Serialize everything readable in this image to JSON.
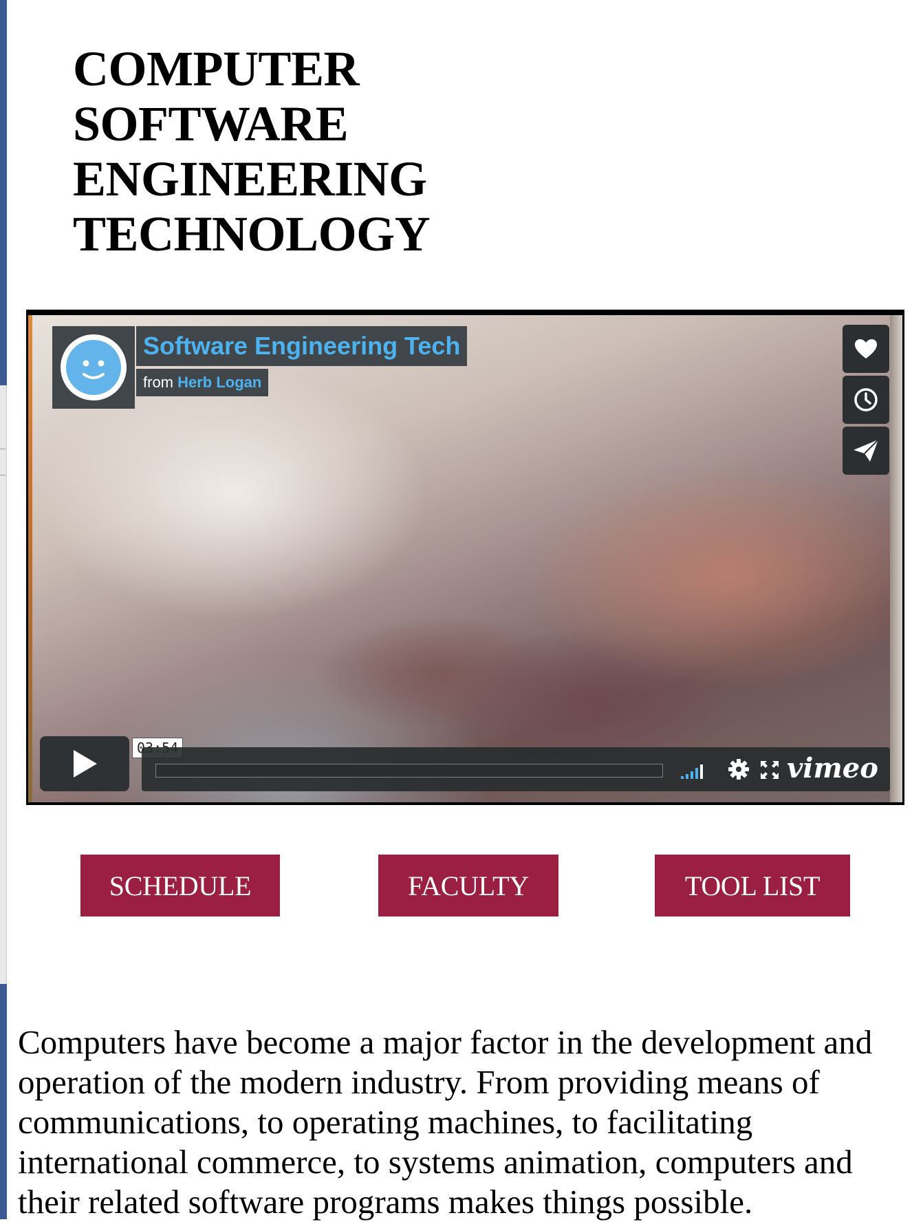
{
  "page": {
    "title_lines": [
      "COMPUTER",
      "SOFTWARE",
      "ENGINEERING",
      "TECHNOLOGY"
    ]
  },
  "video": {
    "title": "Software Engineering Tech",
    "byline_prefix": "from",
    "author": "Herb Logan",
    "duration": "03:54",
    "progress": 0,
    "provider_logo": "vimeo",
    "side_buttons": [
      {
        "icon": "heart-icon",
        "name": "like-button"
      },
      {
        "icon": "clock-icon",
        "name": "watch-later-button"
      },
      {
        "icon": "paper-plane-icon",
        "name": "share-button"
      }
    ],
    "controls": [
      "play-icon",
      "volume-icon",
      "settings-icon",
      "fullscreen-icon"
    ],
    "colors": {
      "accent": "#4cb3f0",
      "badge_bg": "#41464a"
    }
  },
  "nav": {
    "buttons": [
      "SCHEDULE",
      "FACULTY",
      "TOOL LIST"
    ],
    "color": "#9a1f43"
  },
  "intro": {
    "text": "Computers have become a major factor in the development and operation of the modern industry. From providing means of communications, to operating machines, to facilitating international commerce, to systems animation, computers and their related software programs makes things possible."
  }
}
